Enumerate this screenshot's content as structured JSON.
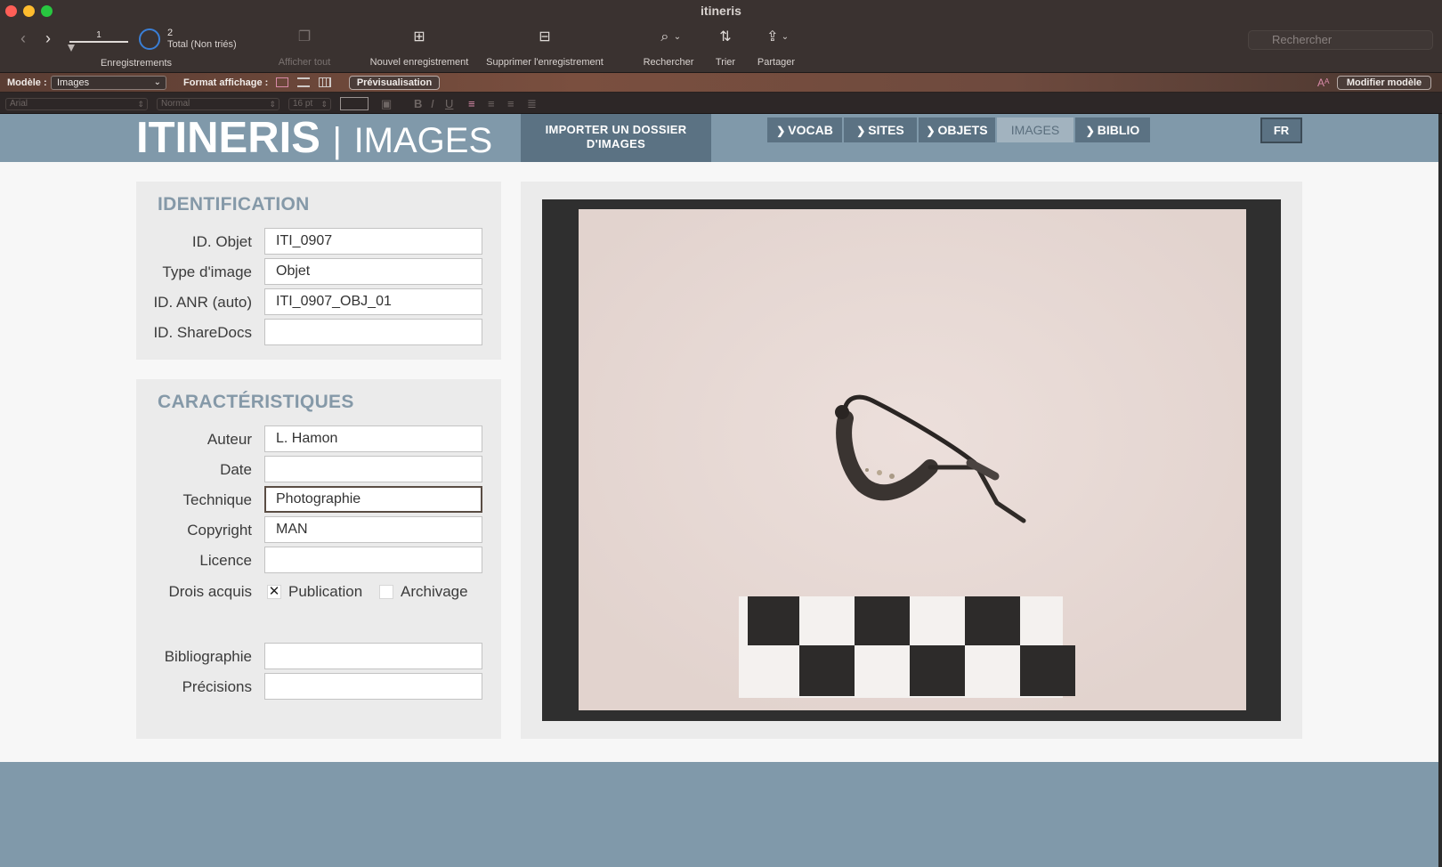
{
  "window": {
    "title": "itineris"
  },
  "toolbar": {
    "record_current": "1",
    "record_count": "2",
    "record_total": "Total (Non triés)",
    "records_caption": "Enregistrements",
    "show_all": "Afficher tout",
    "new_record": "Nouvel enregistrement",
    "delete_record": "Supprimer l'enregistrement",
    "find": "Rechercher",
    "sort": "Trier",
    "share": "Partager",
    "search_placeholder": "Rechercher"
  },
  "layoutbar": {
    "model_label": "Modèle :",
    "model_value": "Images",
    "format_label": "Format affichage :",
    "preview_button": "Prévisualisation",
    "edit_layout_button": "Modifier modèle"
  },
  "formatbar": {
    "font": "Arial",
    "style": "Normal",
    "size": "16 pt"
  },
  "header": {
    "brand_main": "ITINERIS",
    "brand_sep": "|",
    "brand_sub": "IMAGES",
    "import_line1": "IMPORTER UN DOSSIER",
    "import_line2": "D'IMAGES",
    "tabs": [
      {
        "label": "VOCAB",
        "active": false
      },
      {
        "label": "SITES",
        "active": false
      },
      {
        "label": "OBJETS",
        "active": false
      },
      {
        "label": "IMAGES",
        "active": true
      },
      {
        "label": "BIBLIO",
        "active": false
      }
    ],
    "lang": "FR"
  },
  "identification": {
    "title": "IDENTIFICATION",
    "fields": [
      {
        "label": "ID. Objet",
        "value": "ITI_0907"
      },
      {
        "label": "Type d'image",
        "value": "Objet"
      },
      {
        "label": "ID. ANR (auto)",
        "value": "ITI_0907_OBJ_01"
      },
      {
        "label": "ID. ShareDocs",
        "value": ""
      }
    ]
  },
  "characteristics": {
    "title": "CARACTÉRISTIQUES",
    "fields": [
      {
        "label": "Auteur",
        "value": "L. Hamon"
      },
      {
        "label": "Date",
        "value": ""
      },
      {
        "label": "Technique",
        "value": "Photographie"
      },
      {
        "label": "Copyright",
        "value": "MAN"
      },
      {
        "label": "Licence",
        "value": ""
      }
    ],
    "rights_label": "Drois acquis",
    "rights": [
      {
        "label": "Publication",
        "checked": true,
        "mark": "✕"
      },
      {
        "label": "Archivage",
        "checked": false,
        "mark": ""
      }
    ],
    "bibliography_label": "Bibliographie",
    "bibliography_value": "",
    "details_label": "Précisions",
    "details_value": ""
  },
  "colors": {
    "header_band": "#8099aa",
    "nav_tab": "#5b7283",
    "panel_title": "#8599a8"
  }
}
